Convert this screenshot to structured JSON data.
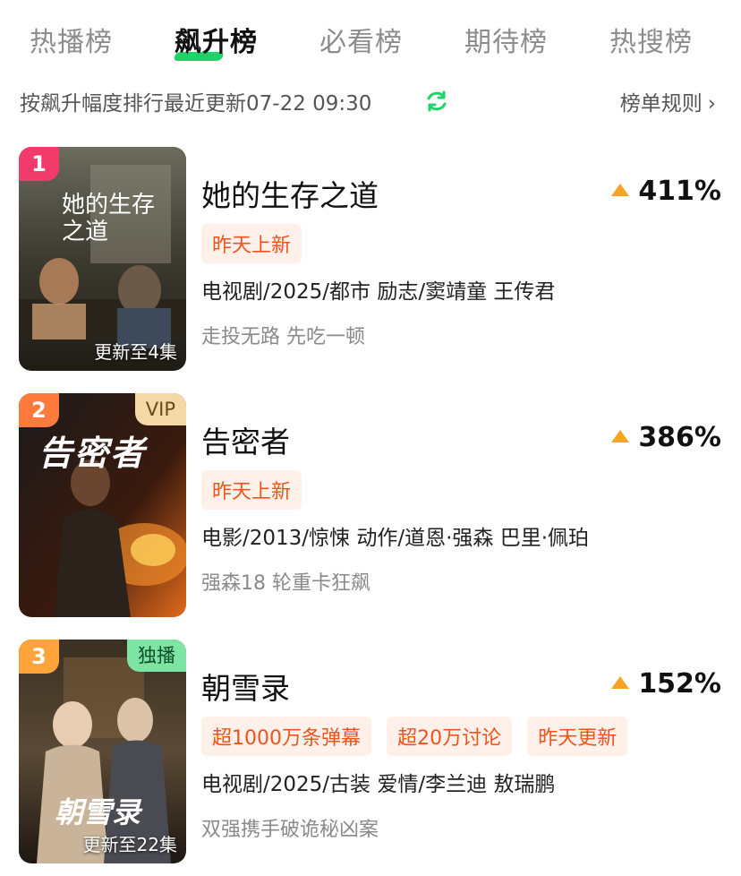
{
  "tabs": [
    {
      "label": "热播榜",
      "active": false
    },
    {
      "label": "飙升榜",
      "active": true
    },
    {
      "label": "必看榜",
      "active": false
    },
    {
      "label": "期待榜",
      "active": false
    },
    {
      "label": "热搜榜",
      "active": false
    }
  ],
  "subbar": {
    "description": "按飙升幅度排行最近更新07-22 09:30",
    "rules_label": "榜单规则",
    "refresh_icon": "refresh-icon"
  },
  "colors": {
    "accent": "#1fd36b",
    "tag_text": "#f0531c",
    "tag_bg": "#fff0ea",
    "trend_up": "#f7a325",
    "rank1": "#f23a6b",
    "rank2": "#ff7a3d",
    "rank3": "#ffa43a"
  },
  "items": [
    {
      "rank": "1",
      "badge": "",
      "poster_caption": "更新至4集",
      "poster_title": "她的生存之道",
      "title": "她的生存之道",
      "trend": "411%",
      "tags": [
        "昨天上新"
      ],
      "meta": "电视剧/2025/都市 励志/窦靖童 王传君",
      "sub": "走投无路 先吃一顿"
    },
    {
      "rank": "2",
      "badge": "VIP",
      "poster_caption": "",
      "poster_title": "告密者",
      "title": "告密者",
      "trend": "386%",
      "tags": [
        "昨天上新"
      ],
      "meta": "电影/2013/惊悚 动作/道恩·强森 巴里·佩珀",
      "sub": "强森18 轮重卡狂飙"
    },
    {
      "rank": "3",
      "badge": "独播",
      "poster_caption": "更新至22集",
      "poster_title": "朝雪录",
      "title": "朝雪录",
      "trend": "152%",
      "tags": [
        "超1000万条弹幕",
        "超20万讨论",
        "昨天更新"
      ],
      "meta": "电视剧/2025/古装 爱情/李兰迪 敖瑞鹏",
      "sub": "双强携手破诡秘凶案"
    }
  ]
}
